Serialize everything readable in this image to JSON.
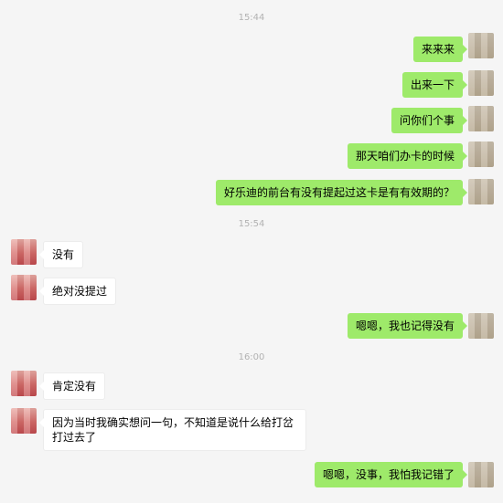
{
  "colors": {
    "background": "#f5f5f5",
    "outgoing_bubble": "#9eea6a",
    "incoming_bubble": "#ffffff",
    "timestamp": "#b2b2b2"
  },
  "timestamps": [
    "15:44",
    "15:54",
    "16:00"
  ],
  "messages": [
    {
      "sender": "me",
      "text": "来来来"
    },
    {
      "sender": "me",
      "text": "出来一下"
    },
    {
      "sender": "me",
      "text": "问你们个事"
    },
    {
      "sender": "me",
      "text": "那天咱们办卡的时候"
    },
    {
      "sender": "me",
      "text": "好乐迪的前台有没有提起过这卡是有有效期的？"
    },
    {
      "sender": "them",
      "text": "没有"
    },
    {
      "sender": "them",
      "text": "绝对没提过"
    },
    {
      "sender": "me",
      "text": "嗯嗯，我也记得没有"
    },
    {
      "sender": "them",
      "text": "肯定没有"
    },
    {
      "sender": "them",
      "text": "因为当时我确实想问一句，不知道是说什么给打岔打过去了"
    },
    {
      "sender": "me",
      "text": "嗯嗯，没事，我怕我记错了"
    }
  ]
}
